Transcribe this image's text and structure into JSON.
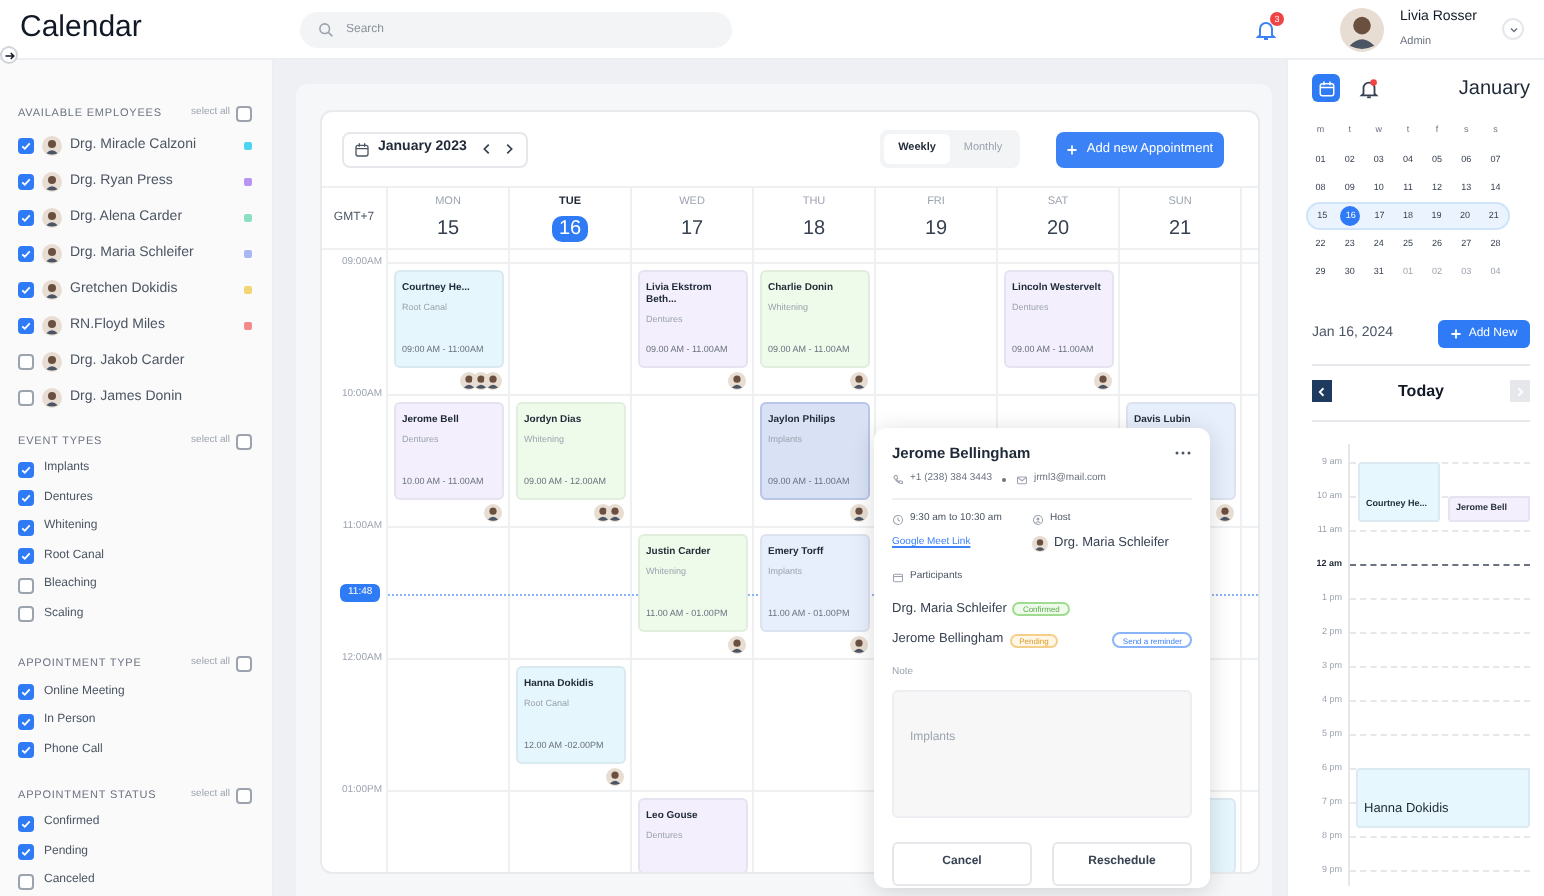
{
  "app": {
    "title": "Calendar"
  },
  "search": {
    "placeholder": "Search"
  },
  "notifications": {
    "count": "3"
  },
  "user": {
    "name": "Livia Rosser",
    "role": "Admin"
  },
  "filters": [
    {
      "title": "AVAILABLE EMPLOYEES",
      "kind": "people",
      "select_all": {
        "label": "select all",
        "checked": false
      },
      "items": [
        {
          "label": "Drg. Miracle Calzoni",
          "checked": true,
          "color": "#4dd4f0"
        },
        {
          "label": "Drg. Ryan Press",
          "checked": true,
          "color": "#b794f4"
        },
        {
          "label": "Drg. Alena Carder",
          "checked": true,
          "color": "#8be0c4"
        },
        {
          "label": "Drg. Maria Schleifer",
          "checked": true,
          "color": "#a9b8f5"
        },
        {
          "label": "Gretchen Dokidis",
          "checked": true,
          "color": "#f2d675"
        },
        {
          "label": "RN.Floyd Miles",
          "checked": true,
          "color": "#f28b8b"
        },
        {
          "label": "Drg. Jakob Carder",
          "checked": false
        },
        {
          "label": "Drg. James Donin",
          "checked": false
        }
      ]
    },
    {
      "title": "EVENT TYPES",
      "kind": "plain",
      "select_all": {
        "label": "select all",
        "checked": false
      },
      "items": [
        {
          "label": "Implants",
          "checked": true
        },
        {
          "label": "Dentures",
          "checked": true
        },
        {
          "label": "Whitening",
          "checked": true
        },
        {
          "label": "Root Canal",
          "checked": true
        },
        {
          "label": "Bleaching",
          "checked": false
        },
        {
          "label": "Scaling",
          "checked": false
        }
      ]
    },
    {
      "title": "APPOINTMENT TYPE",
      "kind": "plain",
      "select_all": {
        "label": "select all",
        "checked": false
      },
      "items": [
        {
          "label": "Online Meeting",
          "checked": true
        },
        {
          "label": "In Person",
          "checked": true
        },
        {
          "label": "Phone Call",
          "checked": true
        }
      ]
    },
    {
      "title": "APPOINTMENT STATUS",
      "kind": "plain",
      "select_all": {
        "label": "select all",
        "checked": false
      },
      "items": [
        {
          "label": "Confirmed",
          "checked": true
        },
        {
          "label": "Pending",
          "checked": true
        },
        {
          "label": "Canceled",
          "checked": false
        }
      ]
    }
  ],
  "calendar": {
    "month": "January 2023",
    "views": [
      {
        "label": "Weekly",
        "selected": true
      },
      {
        "label": "Monthly",
        "selected": false
      }
    ],
    "add_button": "Add new Appointment",
    "timezone": "GMT+7",
    "days": [
      {
        "weekday": "MON",
        "date": "15",
        "selected": false
      },
      {
        "weekday": "TUE",
        "date": "16",
        "selected": true
      },
      {
        "weekday": "WED",
        "date": "17",
        "selected": false
      },
      {
        "weekday": "THU",
        "date": "18",
        "selected": false
      },
      {
        "weekday": "FRI",
        "date": "19",
        "selected": false
      },
      {
        "weekday": "SAT",
        "date": "20",
        "selected": false
      },
      {
        "weekday": "SUN",
        "date": "21",
        "selected": false
      }
    ],
    "now": "11:48",
    "rows": [
      {
        "time": "09:00AM",
        "cells": [
          {
            "name": "Courtney He...",
            "type": "Root Canal",
            "time": "09:00 AM - 11:00AM",
            "color": "#e5f6fd",
            "attendees": [
              {
                "kind": "avatar"
              },
              {
                "kind": "avatar"
              },
              {
                "kind": "avatar"
              }
            ],
            "selected": false
          },
          null,
          {
            "name": "Livia Ekstrom Beth...",
            "type": "Dentures",
            "time": "09.00 AM - 11.00AM",
            "color": "#f3effd",
            "attendees": [
              {
                "kind": "avatar"
              }
            ],
            "selected": false
          },
          {
            "name": "Charlie Donin",
            "type": "Whitening",
            "time": "09.00 AM - 11.00AM",
            "color": "#eefbea",
            "attendees": [
              {
                "kind": "avatar"
              }
            ],
            "selected": false
          },
          null,
          {
            "name": "Lincoln Westervelt",
            "type": "Dentures",
            "time": "09.00 AM - 11.00AM",
            "color": "#f3effd",
            "attendees": [
              {
                "kind": "avatar"
              }
            ],
            "selected": false
          },
          null
        ]
      },
      {
        "time": "10:00AM",
        "cells": [
          {
            "name": "Jerome Bell",
            "type": "Dentures",
            "time": "10.00 AM - 11.00AM",
            "color": "#f3effd",
            "attendees": [
              {
                "kind": "avatar"
              }
            ],
            "selected": false
          },
          {
            "name": "Jordyn Dias",
            "type": "Whitening",
            "time": "09.00 AM - 12.00AM",
            "color": "#eefbea",
            "attendees": [
              {
                "kind": "avatar"
              },
              {
                "kind": "avatar"
              }
            ],
            "selected": false
          },
          null,
          {
            "name": "Jaylon Philips",
            "type": "Implants",
            "time": "09.00 AM - 11.00AM",
            "color": "#d9e1f5",
            "attendees": [
              {
                "kind": "avatar"
              }
            ],
            "selected": true
          },
          null,
          null,
          {
            "name": "Davis Lubin",
            "color": "#e8effc",
            "attendees": [
              {
                "kind": "avatar"
              }
            ],
            "selected": false
          }
        ]
      },
      {
        "time": "11:00AM",
        "cells": [
          null,
          null,
          {
            "name": "Justin Carder",
            "type": "Whitening",
            "time": "11.00 AM - 01.00PM",
            "color": "#eefbea",
            "attendees": [
              {
                "kind": "avatar"
              }
            ],
            "selected": false
          },
          {
            "name": "Emery Torff",
            "type": "Implants",
            "time": "11.00 AM - 01.00PM",
            "color": "#e8effc",
            "attendees": [
              {
                "kind": "avatar"
              }
            ],
            "selected": false
          },
          null,
          null,
          null
        ]
      },
      {
        "time": "12:00AM",
        "cells": [
          null,
          {
            "name": "Hanna Dokidis",
            "type": "Root Canal",
            "time": "12.00 AM -02.00PM",
            "color": "#e5f6fd",
            "attendees": [
              {
                "kind": "avatar"
              }
            ],
            "selected": false
          },
          null,
          null,
          null,
          null,
          null
        ]
      },
      {
        "time": "01:00PM",
        "cells": [
          null,
          null,
          {
            "name": "Leo Gouse",
            "type": "Dentures",
            "color": "#f3effd",
            "selected": false
          },
          null,
          null,
          null,
          {
            "color": "#e5f6fd",
            "selected": false
          }
        ]
      }
    ]
  },
  "popup": {
    "name": "Jerome Bellingham",
    "phone": "+1 (238) 384 3443",
    "email": "jrml3@mail.com",
    "time": "9:30 am to 10:30 am",
    "link": "Google Meet Link",
    "host_label": "Host",
    "host": "Drg. Maria Schleifer",
    "participants_label": "Participants",
    "participants": [
      {
        "name": "Drg. Maria Schleifer",
        "status": "Confirmed",
        "kind": "confirmed"
      },
      {
        "name": "Jerome Bellingham",
        "status": "Pending",
        "kind": "pending",
        "action": "Send a reminder"
      }
    ],
    "note_label": "Note",
    "note": "Implants",
    "buttons": [
      "Cancel",
      "Reschedule"
    ]
  },
  "mini_calendar": {
    "month": "January",
    "weekdays": [
      "m",
      "t",
      "w",
      "t",
      "f",
      "s",
      "s"
    ],
    "weeks": [
      {
        "selected": false,
        "days": [
          {
            "label": "01",
            "selected": false,
            "outside": false
          },
          {
            "label": "02",
            "selected": false,
            "outside": false
          },
          {
            "label": "03",
            "selected": false,
            "outside": false
          },
          {
            "label": "04",
            "selected": false,
            "outside": false
          },
          {
            "label": "05",
            "selected": false,
            "outside": false
          },
          {
            "label": "06",
            "selected": false,
            "outside": false
          },
          {
            "label": "07",
            "selected": false,
            "outside": false
          }
        ]
      },
      {
        "selected": false,
        "days": [
          {
            "label": "08",
            "selected": false,
            "outside": false
          },
          {
            "label": "09",
            "selected": false,
            "outside": false
          },
          {
            "label": "10",
            "selected": false,
            "outside": false
          },
          {
            "label": "11",
            "selected": false,
            "outside": false
          },
          {
            "label": "12",
            "selected": false,
            "outside": false
          },
          {
            "label": "13",
            "selected": false,
            "outside": false
          },
          {
            "label": "14",
            "selected": false,
            "outside": false
          }
        ]
      },
      {
        "selected": true,
        "days": [
          {
            "label": "15",
            "selected": false,
            "outside": false
          },
          {
            "label": "16",
            "selected": true,
            "outside": false
          },
          {
            "label": "17",
            "selected": false,
            "outside": false
          },
          {
            "label": "18",
            "selected": false,
            "outside": false
          },
          {
            "label": "19",
            "selected": false,
            "outside": false
          },
          {
            "label": "20",
            "selected": false,
            "outside": false
          },
          {
            "label": "21",
            "selected": false,
            "outside": false
          }
        ]
      },
      {
        "selected": false,
        "days": [
          {
            "label": "22",
            "selected": false,
            "outside": false
          },
          {
            "label": "23",
            "selected": false,
            "outside": false
          },
          {
            "label": "24",
            "selected": false,
            "outside": false
          },
          {
            "label": "25",
            "selected": false,
            "outside": false
          },
          {
            "label": "26",
            "selected": false,
            "outside": false
          },
          {
            "label": "27",
            "selected": false,
            "outside": false
          },
          {
            "label": "28",
            "selected": false,
            "outside": false
          }
        ]
      },
      {
        "selected": false,
        "days": [
          {
            "label": "29",
            "selected": false,
            "outside": false
          },
          {
            "label": "30",
            "selected": false,
            "outside": false
          },
          {
            "label": "31",
            "selected": false,
            "outside": false
          },
          {
            "label": "01",
            "selected": false,
            "outside": true
          },
          {
            "label": "02",
            "selected": false,
            "outside": true
          },
          {
            "label": "03",
            "selected": false,
            "outside": true
          },
          {
            "label": "04",
            "selected": false,
            "outside": true
          }
        ]
      }
    ]
  },
  "day_view": {
    "date": "Jan 16, 2024",
    "add_button": "Add New",
    "title": "Today",
    "hours": [
      {
        "label": "9 am",
        "current": false,
        "events": [
          {
            "name": "Courtney He...",
            "kind": "block",
            "color": "#e6f7fd"
          }
        ]
      },
      {
        "label": "10 am",
        "current": false,
        "events": [
          {
            "name": "Jerome Bell",
            "kind": "strip",
            "color": "#f3effd"
          }
        ]
      },
      {
        "label": "11 am",
        "current": false
      },
      {
        "label": "12 am",
        "current": true
      },
      {
        "label": "1 pm",
        "current": false
      },
      {
        "label": "2 pm",
        "current": false
      },
      {
        "label": "3 pm",
        "current": false
      },
      {
        "label": "4 pm",
        "current": false
      },
      {
        "label": "5 pm",
        "current": false
      },
      {
        "label": "6 pm",
        "current": false,
        "events": [
          {
            "name": "Hanna Dokidis",
            "kind": "banner",
            "color": "#e6f7fd"
          }
        ]
      },
      {
        "label": "7 pm",
        "current": false
      },
      {
        "label": "8 pm",
        "current": false
      },
      {
        "label": "9 pm",
        "current": false
      }
    ]
  }
}
